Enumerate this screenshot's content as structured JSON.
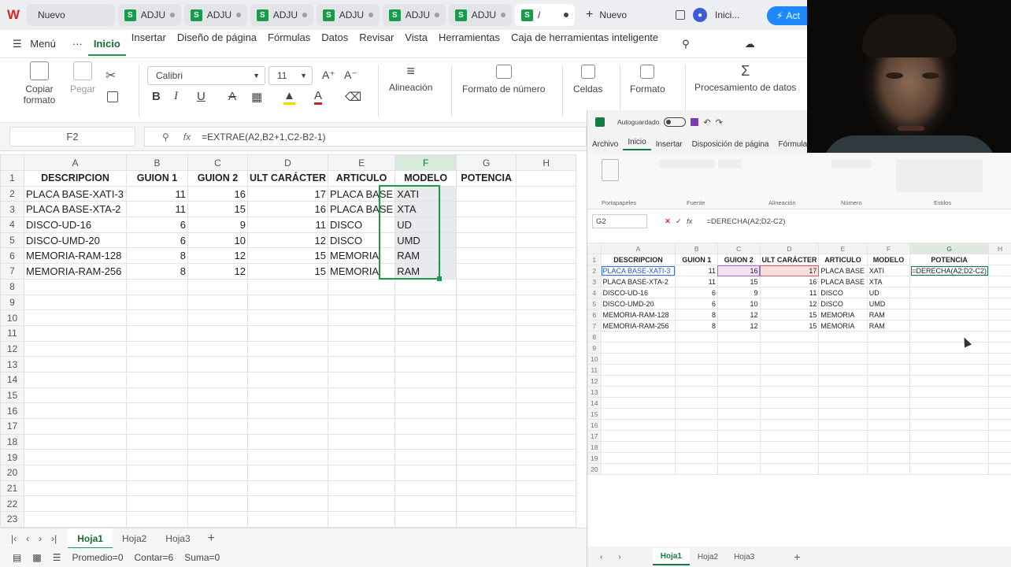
{
  "tabs": [
    {
      "label": "Nuevo",
      "kind": "home"
    },
    {
      "label": "ADJU",
      "kind": "sheet"
    },
    {
      "label": "ADJU",
      "kind": "sheet"
    },
    {
      "label": "ADJU",
      "kind": "sheet"
    },
    {
      "label": "ADJU",
      "kind": "sheet"
    },
    {
      "label": "ADJU",
      "kind": "sheet"
    },
    {
      "label": "ADJU",
      "kind": "sheet"
    },
    {
      "label": "/",
      "kind": "sheet-active"
    }
  ],
  "new_tab_label": "Nuevo",
  "account_label": "Inici...",
  "action_label": "Act",
  "menu": {
    "menu_label": "Menú",
    "items": [
      "Inicio",
      "Insertar",
      "Diseño de página",
      "Fórmulas",
      "Datos",
      "Revisar",
      "Vista",
      "Herramientas",
      "Caja de herramientas inteligente"
    ]
  },
  "ribbon": {
    "copy_format": "Copiar formato",
    "paste": "Pegar",
    "font_name": "Calibri",
    "font_size": "11",
    "alignment": "Alineación",
    "number_format": "Formato de número",
    "cells": "Celdas",
    "format": "Formato",
    "data_processing": "Procesamiento de datos"
  },
  "formula_bar": {
    "cell_ref": "F2",
    "fx": "fx",
    "formula": "=EXTRAE(A2,B2+1,C2-B2-1)"
  },
  "grid": {
    "columns": [
      "A",
      "B",
      "C",
      "D",
      "E",
      "F",
      "G",
      "H"
    ],
    "headers": [
      "DESCRIPCION",
      "GUION 1",
      "GUION 2",
      "ULT CARÁCTER",
      "ARTICULO",
      "MODELO",
      "POTENCIA",
      ""
    ],
    "rows": [
      [
        "PLACA BASE-XATI-3",
        "11",
        "16",
        "17",
        "PLACA BASE",
        "XATI",
        "",
        ""
      ],
      [
        "PLACA BASE-XTA-2",
        "11",
        "15",
        "16",
        "PLACA BASE",
        "XTA",
        "",
        ""
      ],
      [
        "DISCO-UD-16",
        "6",
        "9",
        "11",
        "DISCO",
        "UD",
        "",
        ""
      ],
      [
        "DISCO-UMD-20",
        "6",
        "10",
        "12",
        "DISCO",
        "UMD",
        "",
        ""
      ],
      [
        "MEMORIA-RAM-128",
        "8",
        "12",
        "15",
        "MEMORIA",
        "RAM",
        "",
        ""
      ],
      [
        "MEMORIA-RAM-256",
        "8",
        "12",
        "15",
        "MEMORIA",
        "RAM",
        "",
        ""
      ]
    ],
    "total_rows": 23
  },
  "sheet_tabs": [
    "Hoja1",
    "Hoja2",
    "Hoja3"
  ],
  "status": {
    "average": "Promedio=0",
    "count": "Contar=6",
    "sum": "Suma=0"
  },
  "overlay": {
    "autosave": "Autoguardado",
    "menu": [
      "Archivo",
      "Inicio",
      "Insertar",
      "Disposición de página",
      "Fórmula"
    ],
    "ribbon_labels": [
      "Portapapeles",
      "Fuente",
      "Alineación",
      "Número",
      "Estilos"
    ],
    "cell_ref": "G2",
    "fx": "fx",
    "formula": "=DERECHA(A2;D2-C2)",
    "columns": [
      "A",
      "B",
      "C",
      "D",
      "E",
      "F",
      "G",
      "H"
    ],
    "headers": [
      "DESCRIPCION",
      "GUION 1",
      "GUION 2",
      "ULT CARÁCTER",
      "ARTICULO",
      "MODELO",
      "POTENCIA",
      ""
    ],
    "rows": [
      [
        "PLACA BASE-XATI-3",
        "11",
        "16",
        "17",
        "PLACA BASE",
        "XATI",
        "=DERECHA(A2;D2-C2)",
        ""
      ],
      [
        "PLACA BASE-XTA-2",
        "11",
        "15",
        "16",
        "PLACA BASE",
        "XTA",
        "",
        ""
      ],
      [
        "DISCO-UD-16",
        "6",
        "9",
        "11",
        "DISCO",
        "UD",
        "",
        ""
      ],
      [
        "DISCO-UMD-20",
        "6",
        "10",
        "12",
        "DISCO",
        "UMD",
        "",
        ""
      ],
      [
        "MEMORIA-RAM-128",
        "8",
        "12",
        "15",
        "MEMORIA",
        "RAM",
        "",
        ""
      ],
      [
        "MEMORIA-RAM-256",
        "8",
        "12",
        "15",
        "MEMORIA",
        "RAM",
        "",
        ""
      ]
    ],
    "total_rows": 20,
    "sheet_tabs": [
      "Hoja1",
      "Hoja2",
      "Hoja3"
    ]
  },
  "colors": {
    "wps_green": "#1a9a4b",
    "excel_green": "#107c41",
    "action_blue": "#1e88ff"
  }
}
